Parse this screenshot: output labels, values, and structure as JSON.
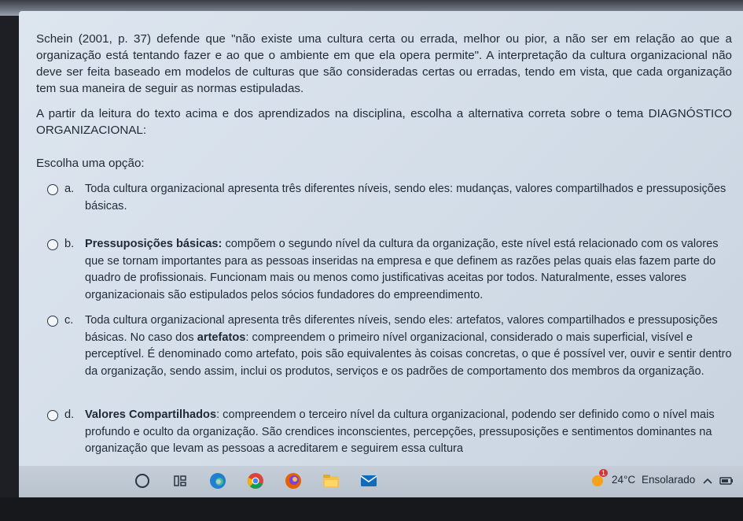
{
  "question": {
    "paragraph1": "Schein (2001, p. 37) defende que \"não existe uma cultura certa ou errada, melhor ou pior, a não ser em relação ao que a organização está tentando fazer e ao que o ambiente em que ela opera permite\". A interpretação da cultura organizacional não deve ser feita baseado em modelos de culturas que são consideradas certas ou erradas, tendo em vista, que cada organização tem sua maneira de seguir as normas estipuladas.",
    "paragraph2": "A partir da leitura do texto acima e dos aprendizados na disciplina, escolha a alternativa correta sobre o tema DIAGNÓSTICO ORGANIZACIONAL:",
    "prompt": "Escolha uma opção:"
  },
  "options": [
    {
      "letter": "a.",
      "text": "Toda cultura organizacional apresenta três diferentes níveis, sendo eles: mudanças, valores compartilhados e pressuposições básicas."
    },
    {
      "letter": "b.",
      "bold": "Pressuposições básicas:",
      "text": " compõem o segundo nível da cultura da organização, este nível está relacionado com os valores que se tornam importantes para as pessoas inseridas na empresa e que definem as razões pelas quais elas fazem parte do quadro de profissionais. Funcionam mais ou menos como justificativas aceitas por todos. Naturalmente, esses valores organizacionais são estipulados pelos sócios fundadores do empreendimento."
    },
    {
      "letter": "c.",
      "text_pre": "Toda cultura organizacional apresenta três diferentes níveis, sendo eles: artefatos, valores compartilhados e pressuposições básicas. No caso dos ",
      "bold": "artefatos",
      "text": ": compreendem o primeiro nível organizacional, considerado o mais superficial, visível e perceptível. É denominado como artefato, pois são equivalentes às coisas concretas, o que é possível ver, ouvir e sentir dentro da organização, sendo assim, inclui os produtos, serviços e os padrões de comportamento dos membros da organização."
    },
    {
      "letter": "d.",
      "bold": "Valores Compartilhados",
      "text": ": compreendem o terceiro nível da cultura organizacional, podendo ser definido como o nível mais profundo e oculto da organização. São crendices inconscientes, percepções, pressuposições e sentimentos dominantes na organização que levam as pessoas a acreditarem e seguirem essa cultura"
    }
  ],
  "taskbar": {
    "weather_temp": "24°C",
    "weather_text": "Ensolarado",
    "badge": "1",
    "icons": [
      "search-icon",
      "task-view-icon",
      "edge-icon",
      "chrome-icon",
      "firefox-icon",
      "file-explorer-icon",
      "mail-icon",
      "weather-icon",
      "chevron-up-icon",
      "battery-icon"
    ]
  },
  "colors": {
    "screen_bg": "#d6dfe9",
    "text": "#1f2a36",
    "taskbar_bg": "#bfc8d2"
  }
}
